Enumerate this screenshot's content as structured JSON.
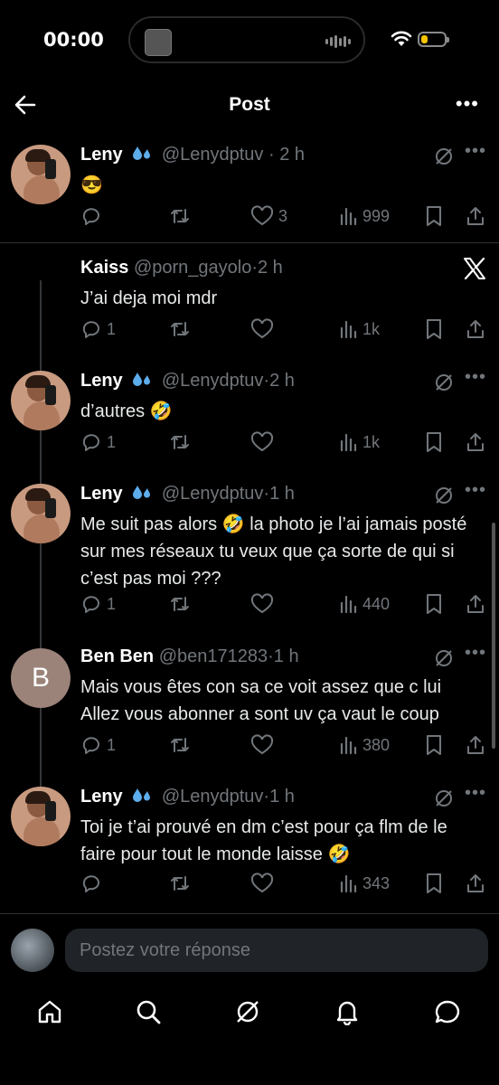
{
  "status_bar": {
    "time": "00:00",
    "battery_level": 0.3,
    "battery_color": "#f5c400"
  },
  "header": {
    "title": "Post",
    "back_icon": "arrow-left-icon",
    "more_icon": "more-horizontal-icon",
    "more_label": "•••"
  },
  "posts": [
    {
      "name": "Leny",
      "handle": "@Lenydptuv",
      "sep": "·",
      "time": "2 h",
      "text": "😎",
      "replies": "",
      "reposts": "",
      "likes": "3",
      "views": "999"
    },
    {
      "name": "Kaiss",
      "handle": "@porn_gayolo",
      "sep": "·",
      "time": "2 h",
      "text": "J’ai deja moi mdr",
      "replies": "1",
      "reposts": "",
      "likes": "",
      "views": "1k"
    },
    {
      "name": "Leny",
      "handle": "@Lenydptuv",
      "sep": "·",
      "time": "2 h",
      "text": "d’autres 🤣",
      "replies": "1",
      "reposts": "",
      "likes": "",
      "views": "1k"
    },
    {
      "name": "Leny",
      "handle": "@Lenydptuv",
      "sep": "·",
      "time": "1 h",
      "text": "Me suit pas alors 🤣 la photo je l’ai jamais posté sur mes réseaux tu veux que ça sorte de qui si c’est pas moi ???",
      "replies": "1",
      "reposts": "",
      "likes": "",
      "views": "440"
    },
    {
      "name": "Ben Ben",
      "handle": "@ben171283",
      "sep": "·",
      "time": "1 h",
      "avatar_letter": "B",
      "text": "Mais vous êtes con sa ce voit assez que c lui Allez vous abonner a sont uv ça vaut le coup",
      "replies": "1",
      "reposts": "",
      "likes": "",
      "views": "380"
    },
    {
      "name": "Leny",
      "handle": "@Lenydptuv",
      "sep": "·",
      "time": "1 h",
      "text": "Toi je t’ai prouvé en dm c’est pour ça flm de le faire pour tout le monde laisse 🤣",
      "replies": "",
      "reposts": "",
      "likes": "",
      "views": "343"
    }
  ],
  "reply_box": {
    "placeholder": "Postez votre réponse"
  },
  "tab_bar": {
    "items": [
      "home-icon",
      "search-icon",
      "grok-icon",
      "notifications-icon",
      "messages-icon"
    ]
  },
  "colors": {
    "background": "#000000",
    "text": "#e7e9ea",
    "muted": "#71767b",
    "divider": "#2f3336"
  }
}
